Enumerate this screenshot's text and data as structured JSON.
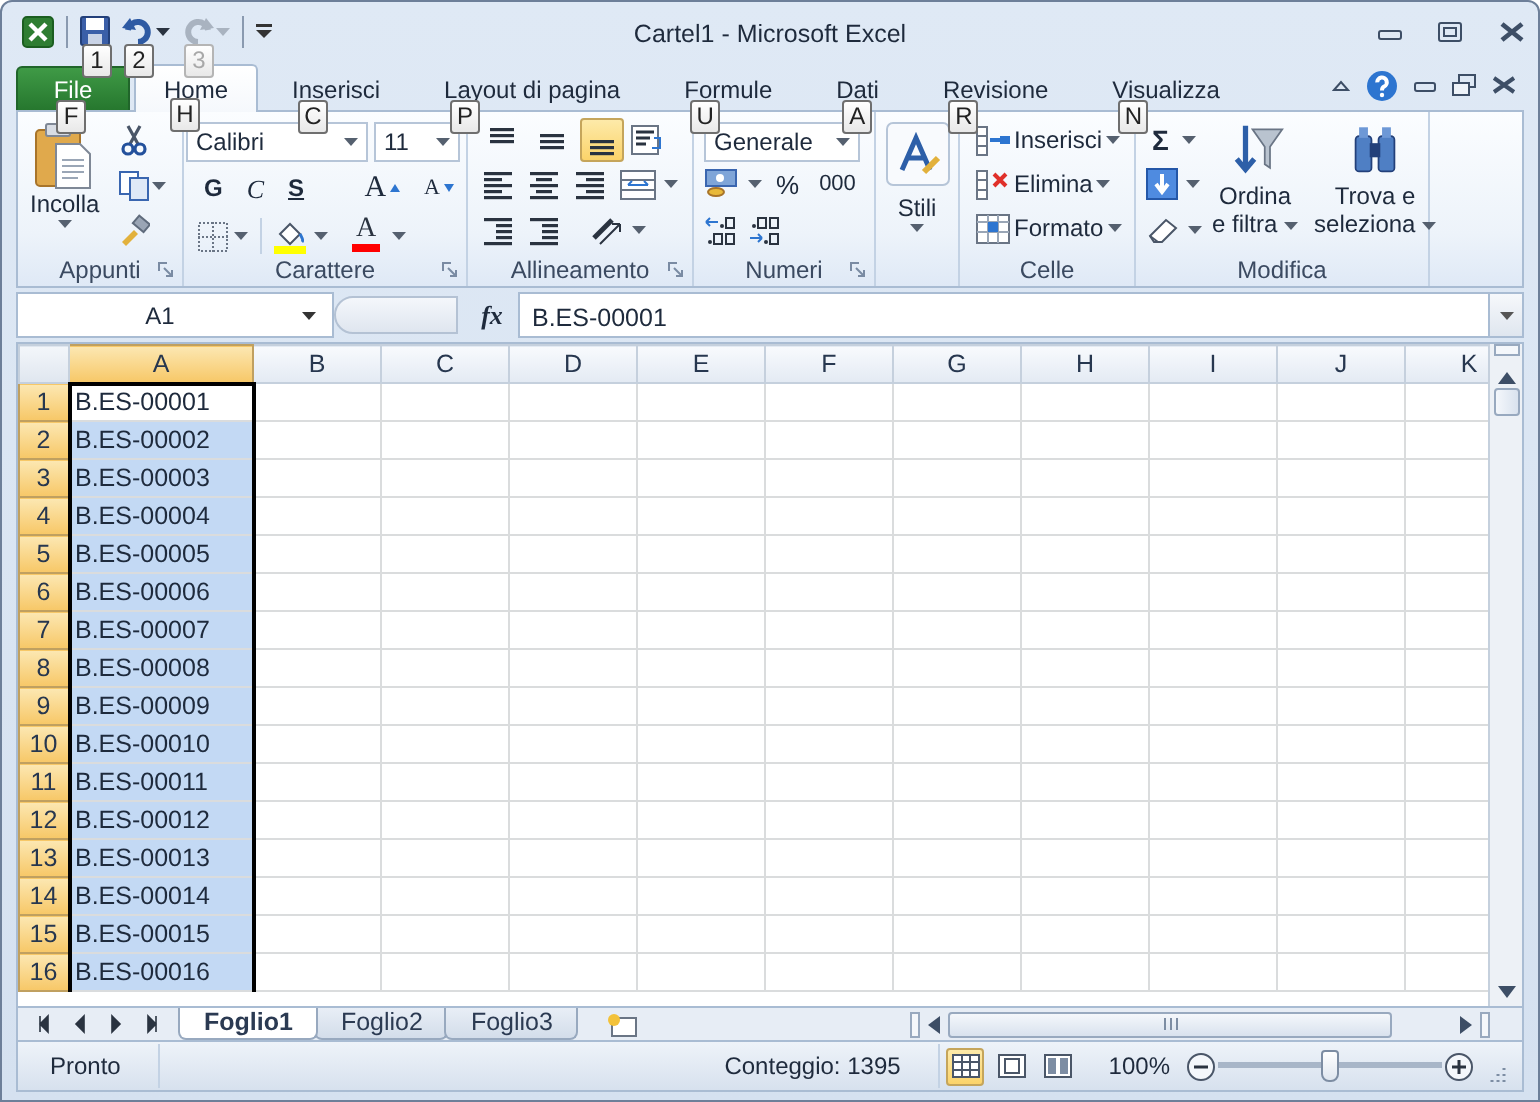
{
  "window": {
    "title": "Cartel1  -  Microsoft Excel"
  },
  "quick_access": [
    {
      "keytip": "1",
      "disabled": false
    },
    {
      "keytip": "2",
      "disabled": false
    },
    {
      "keytip": "3",
      "disabled": true
    }
  ],
  "tabs": [
    {
      "label": "File",
      "keytip": "F",
      "kind": "file",
      "selected": false
    },
    {
      "label": "Home",
      "keytip": "H",
      "kind": "tab",
      "selected": true
    },
    {
      "label": "Inserisci",
      "keytip": "C",
      "kind": "tab",
      "selected": false
    },
    {
      "label": "Layout di pagina",
      "keytip": "P",
      "kind": "tab",
      "selected": false
    },
    {
      "label": "Formule",
      "keytip": "U",
      "kind": "tab",
      "selected": false
    },
    {
      "label": "Dati",
      "keytip": "A",
      "kind": "tab",
      "selected": false
    },
    {
      "label": "Revisione",
      "keytip": "R",
      "kind": "tab",
      "selected": false
    },
    {
      "label": "Visualizza",
      "keytip": "N",
      "kind": "tab",
      "selected": false
    }
  ],
  "clipboard": {
    "label": "Appunti",
    "paste": "Incolla"
  },
  "font": {
    "label": "Carattere",
    "name": "Calibri",
    "size": "11",
    "bold": "G",
    "italic": "C",
    "underline": "S",
    "grow": "A",
    "shrink": "A",
    "font_color_button": "A"
  },
  "alignment": {
    "label": "Allineamento",
    "vertical_align": [
      {
        "selected": false
      },
      {
        "selected": false
      },
      {
        "selected": true
      }
    ]
  },
  "number": {
    "label": "Numeri",
    "format": "Generale",
    "percent": "%",
    "thousands": "000"
  },
  "styles": {
    "label": "Stili"
  },
  "cells": {
    "label": "Celle",
    "items": [
      "Inserisci",
      "Elimina",
      "Formato"
    ]
  },
  "editing": {
    "label": "Modifica",
    "sum": "Σ",
    "sort": [
      "Ordina",
      "e filtra"
    ],
    "find": [
      "Trova e",
      "seleziona"
    ]
  },
  "formula_bar": {
    "name_box": "A1",
    "fx": "fx",
    "formula": "B.ES-00001"
  },
  "sheet": {
    "columns": [
      {
        "label": "A",
        "selected": true
      },
      {
        "label": "B",
        "selected": false
      },
      {
        "label": "C",
        "selected": false
      },
      {
        "label": "D",
        "selected": false
      },
      {
        "label": "E",
        "selected": false
      },
      {
        "label": "F",
        "selected": false
      },
      {
        "label": "G",
        "selected": false
      },
      {
        "label": "H",
        "selected": false
      },
      {
        "label": "I",
        "selected": false
      },
      {
        "label": "J",
        "selected": false
      },
      {
        "label": "K",
        "selected": false
      }
    ],
    "rows": [
      {
        "number": "1",
        "value": "B.ES-00001",
        "selected": true,
        "active": true
      },
      {
        "number": "2",
        "value": "B.ES-00002",
        "selected": true,
        "active": false
      },
      {
        "number": "3",
        "value": "B.ES-00003",
        "selected": true,
        "active": false
      },
      {
        "number": "4",
        "value": "B.ES-00004",
        "selected": true,
        "active": false
      },
      {
        "number": "5",
        "value": "B.ES-00005",
        "selected": true,
        "active": false
      },
      {
        "number": "6",
        "value": "B.ES-00006",
        "selected": true,
        "active": false
      },
      {
        "number": "7",
        "value": "B.ES-00007",
        "selected": true,
        "active": false
      },
      {
        "number": "8",
        "value": "B.ES-00008",
        "selected": true,
        "active": false
      },
      {
        "number": "9",
        "value": "B.ES-00009",
        "selected": true,
        "active": false
      },
      {
        "number": "10",
        "value": "B.ES-00010",
        "selected": true,
        "active": false
      },
      {
        "number": "11",
        "value": "B.ES-00011",
        "selected": true,
        "active": false
      },
      {
        "number": "12",
        "value": "B.ES-00012",
        "selected": true,
        "active": false
      },
      {
        "number": "13",
        "value": "B.ES-00013",
        "selected": true,
        "active": false
      },
      {
        "number": "14",
        "value": "B.ES-00014",
        "selected": true,
        "active": false
      },
      {
        "number": "15",
        "value": "B.ES-00015",
        "selected": true,
        "active": false
      },
      {
        "number": "16",
        "value": "B.ES-00016",
        "selected": true,
        "active": false
      }
    ]
  },
  "sheet_tabs": [
    {
      "label": "Foglio1",
      "selected": true
    },
    {
      "label": "Foglio2",
      "selected": false
    },
    {
      "label": "Foglio3",
      "selected": false
    }
  ],
  "status_bar": {
    "status": "Pronto",
    "count": "Conteggio: 1395",
    "views": [
      {
        "selected": true
      },
      {
        "selected": false
      },
      {
        "selected": false
      }
    ],
    "zoom": "100%",
    "zoom_slider": {
      "level": 0.5
    }
  }
}
